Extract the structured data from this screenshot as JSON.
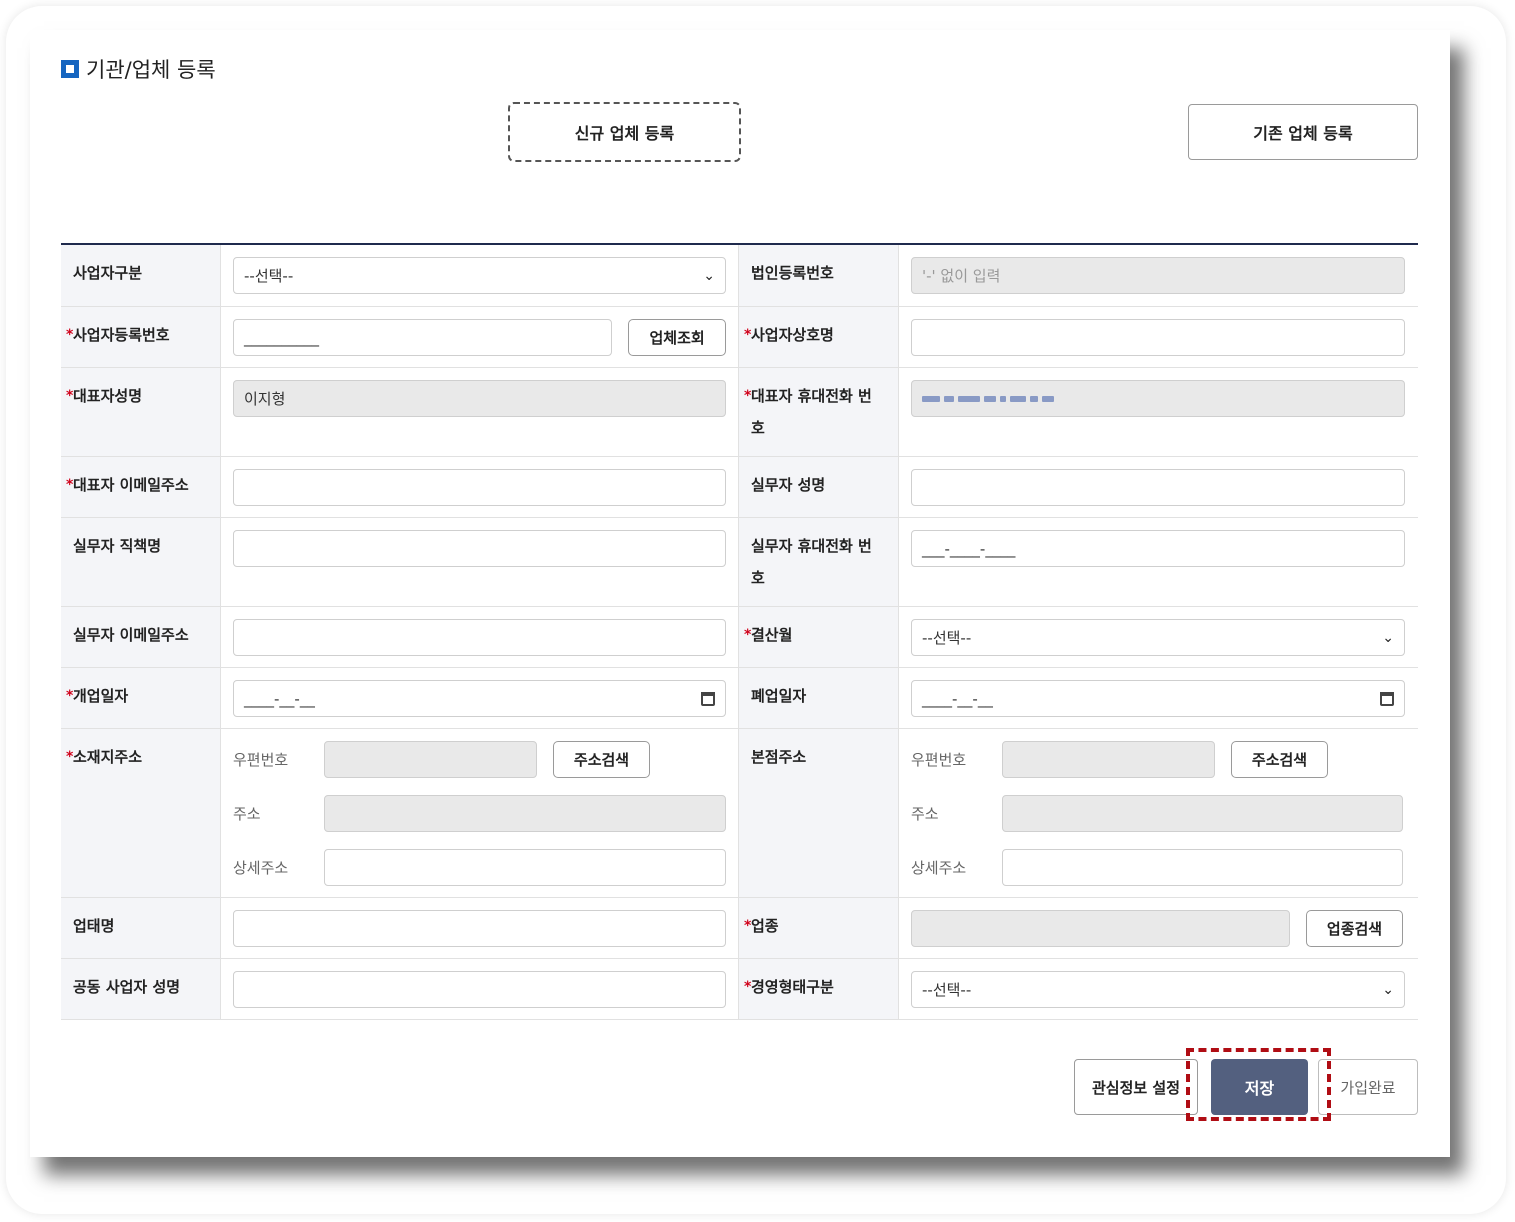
{
  "page": {
    "title": "기관/업체 등록"
  },
  "top_buttons": {
    "new": "신규 업체 등록",
    "existing": "기존 업체 등록"
  },
  "form": {
    "business_type": {
      "label": "사업자구분",
      "value": "--선택--"
    },
    "corp_reg_no": {
      "label": "법인등록번호",
      "placeholder": "'-' 없이 입력"
    },
    "biz_reg_no": {
      "label": "사업자등록번호",
      "value": "__________",
      "button": "업체조회"
    },
    "biz_name": {
      "label": "사업자상호명",
      "value": ""
    },
    "ceo_name": {
      "label": "대표자성명",
      "value": "이지형"
    },
    "ceo_phone": {
      "label_1": "대표자 휴대전화 번",
      "label_2": "호"
    },
    "ceo_email": {
      "label": "대표자 이메일주소",
      "value": ""
    },
    "staff_name": {
      "label": "실무자 성명",
      "value": ""
    },
    "staff_title": {
      "label": "실무자 직책명",
      "value": ""
    },
    "staff_phone": {
      "label_1": "실무자 휴대전화 번",
      "label_2": "호",
      "value": "___-____-____"
    },
    "staff_email": {
      "label": "실무자 이메일주소",
      "value": ""
    },
    "settle_month": {
      "label": "결산월",
      "value": "--선택--"
    },
    "open_date": {
      "label": "개업일자",
      "value": "____-__-__"
    },
    "close_date": {
      "label": "폐업일자",
      "value": "____-__-__"
    },
    "location_addr": {
      "label": "소재지주소",
      "zip_label": "우편번호",
      "addr_label": "주소",
      "detail_label": "상세주소",
      "button": "주소검색"
    },
    "hq_addr": {
      "label": "본점주소",
      "zip_label": "우편번호",
      "addr_label": "주소",
      "detail_label": "상세주소",
      "button": "주소검색"
    },
    "business_status": {
      "label": "업태명",
      "value": ""
    },
    "business_item": {
      "label": "업종",
      "button": "업종검색"
    },
    "joint_ceo": {
      "label": "공동 사업자 성명",
      "value": ""
    },
    "mgmt_type": {
      "label": "경영형태구분",
      "value": "--선택--"
    }
  },
  "actions": {
    "interest": "관심정보 설정",
    "save": "저장",
    "done": "가입완료"
  },
  "colors": {
    "accent": "#1565c0",
    "save_button": "#53607f",
    "highlight": "#b00d14",
    "required": "#d0021b"
  }
}
